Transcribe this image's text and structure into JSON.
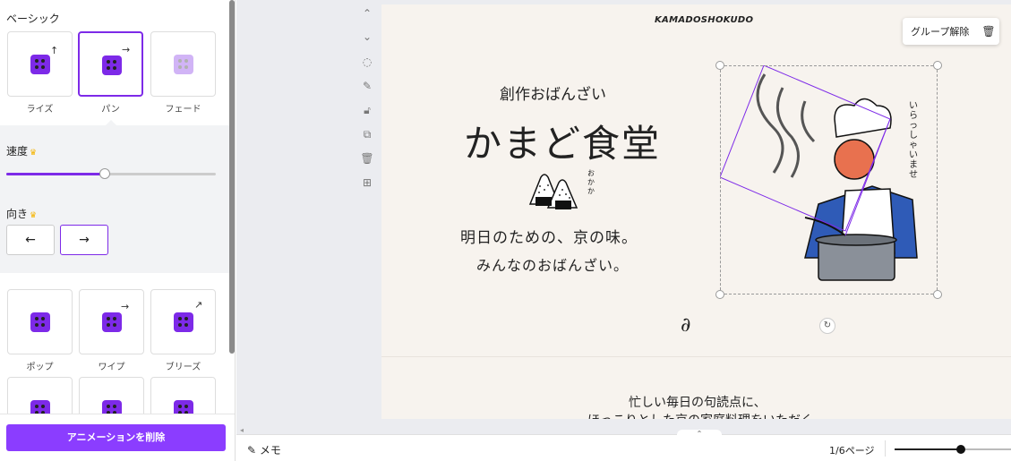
{
  "panel": {
    "basic_title": "ベーシック",
    "basic_tiles": [
      {
        "label": "ライズ",
        "arrow": "↑"
      },
      {
        "label": "パン",
        "arrow": "→"
      },
      {
        "label": "フェード",
        "arrow": ""
      }
    ],
    "speed_label": "速度",
    "speed_value": 0.47,
    "direction_label": "向き",
    "direction_left": "←",
    "direction_right": "→",
    "more_tiles": [
      {
        "label": "ポップ",
        "arrow": ""
      },
      {
        "label": "ワイプ",
        "arrow": "→"
      },
      {
        "label": "ブリーズ",
        "arrow": "↗"
      }
    ],
    "delete_label": "アニメーションを削除",
    "accent_color": "#8b3dff"
  },
  "canvas": {
    "logo": "KAMADOSHOKUDO",
    "subtitle": "創作おばんざい",
    "title": "かまど食堂",
    "okaka": "おかか",
    "line1": "明日のための、京の味。",
    "line2": "みんなのおばんざい。",
    "vertical_text": "いらっしゃいませ",
    "below1": "忙しい毎日の句読点に、",
    "below2": "ほっこりとした京の家庭料理をいただく",
    "squiggle": "∂"
  },
  "toolbar": {
    "ungroup_label": "グループ解除"
  },
  "bottom": {
    "memo_label": "メモ",
    "page_count": "1/6ページ",
    "zoom_value": 0.57
  }
}
